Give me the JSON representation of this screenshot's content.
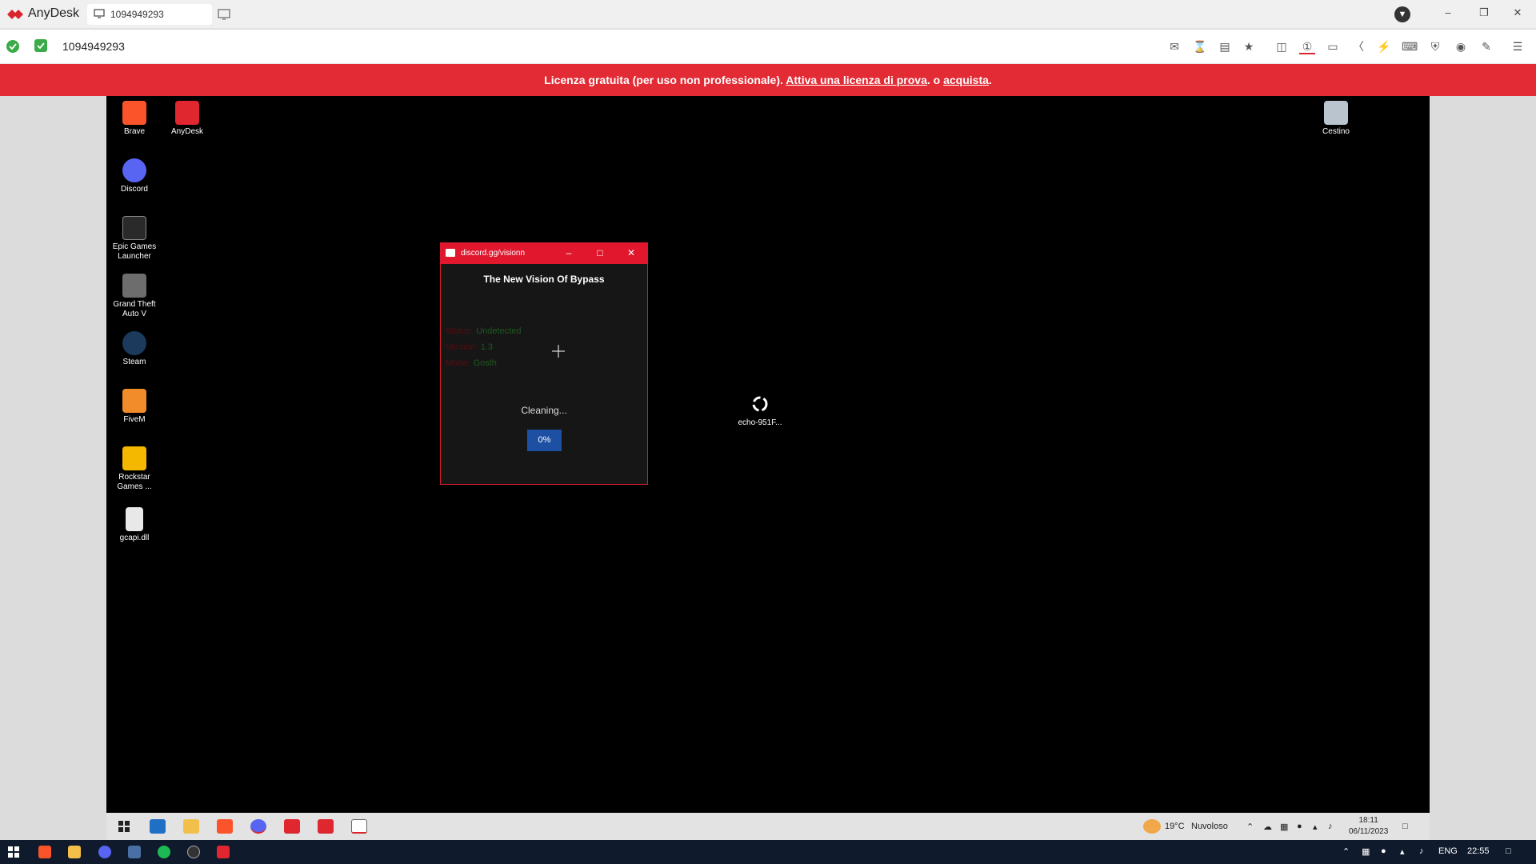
{
  "app": {
    "name": "AnyDesk",
    "tab_id": "1094949293",
    "address": "1094949293"
  },
  "banner": {
    "text": "Licenza gratuita (per uso non professionale).",
    "link1": "Attiva una licenza di prova",
    "sep": ". o",
    "link2": "acquista",
    "end": "."
  },
  "colors": {
    "accent": "#e32b35",
    "ok": "#3aab48",
    "dialog_red": "#e0172d",
    "progress_blue": "#1d4fa3"
  },
  "desktop_icons": [
    {
      "label": "Brave"
    },
    {
      "label": "AnyDesk"
    },
    {
      "label": "Cestino"
    },
    {
      "label": "Discord"
    },
    {
      "label": "Epic Games Launcher"
    },
    {
      "label": "Grand Theft Auto V"
    },
    {
      "label": "Steam"
    },
    {
      "label": "FiveM"
    },
    {
      "label": "Rockstar Games ..."
    },
    {
      "label": "gcapi.dll"
    },
    {
      "label": "echo-951F..."
    }
  ],
  "dialog": {
    "title": "discord.gg/visionn",
    "heading": "The New Vision Of Bypass",
    "rows": [
      {
        "key": "Status:",
        "value": "Undetected"
      },
      {
        "key": "Version:",
        "value": "1.3"
      },
      {
        "key": "Mode:",
        "value": "Gosth"
      }
    ],
    "status_text": "Cleaning...",
    "progress_label": "0%",
    "progress": 0
  },
  "remote_taskbar": {
    "weather_temp": "19°C",
    "weather_desc": "Nuvoloso",
    "time": "18:11",
    "date": "06/11/2023"
  },
  "local_taskbar": {
    "lang": "ENG",
    "time": "22:55"
  }
}
